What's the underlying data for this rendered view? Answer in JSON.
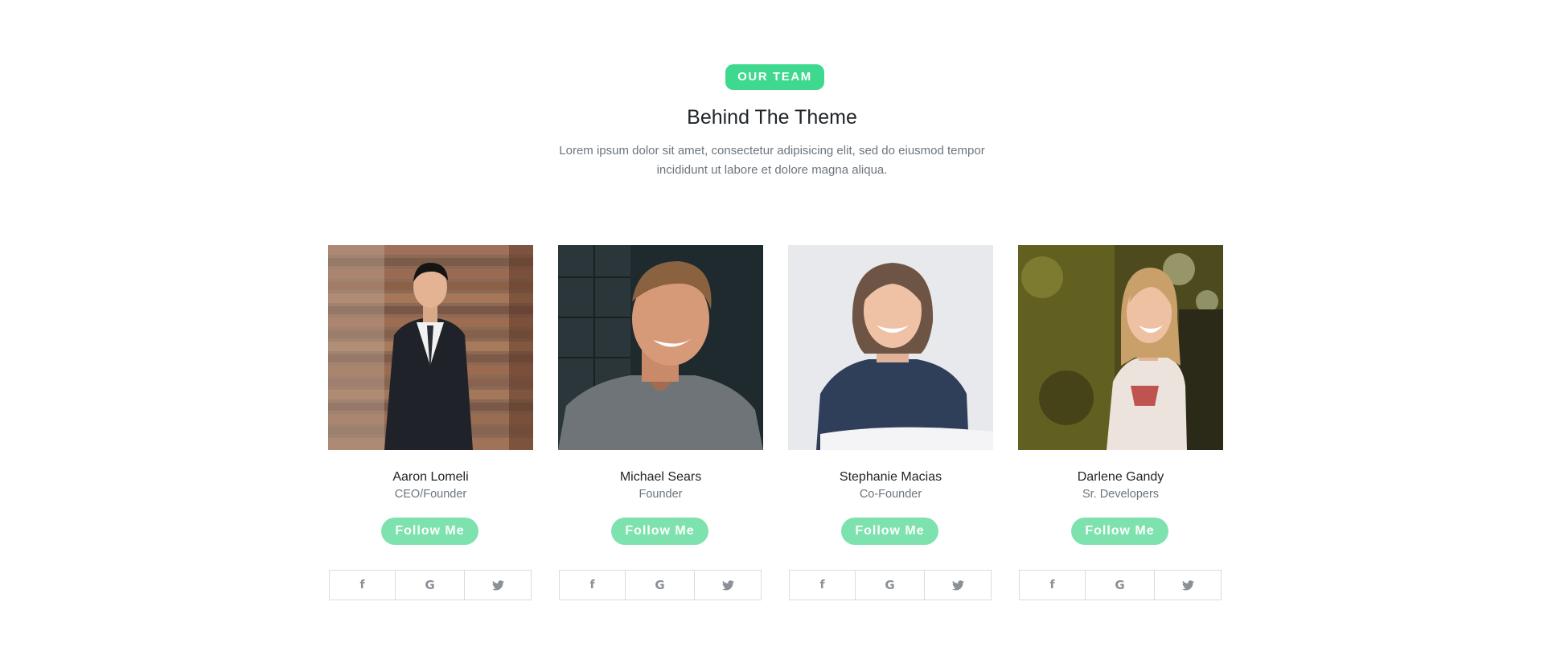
{
  "header": {
    "badge": "OUR TEAM",
    "title": "Behind The Theme",
    "description": "Lorem ipsum dolor sit amet, consectetur adipisicing elit, sed do eiusmod tempor incididunt ut labore et dolore magna aliqua."
  },
  "colors": {
    "accent": "#3ed88e",
    "follow_button": "#7ee2ae",
    "heading": "#212529",
    "muted_text": "#6c757d",
    "social_border": "#d9dcdf"
  },
  "team": [
    {
      "name": "Aaron Lomeli",
      "role": "CEO/Founder",
      "follow_label": "Follow Me",
      "photo": "man-in-suit-photo"
    },
    {
      "name": "Michael Sears",
      "role": "Founder",
      "follow_label": "Follow Me",
      "photo": "smiling-man-photo"
    },
    {
      "name": "Stephanie Macias",
      "role": "Co-Founder",
      "follow_label": "Follow Me",
      "photo": "smiling-woman-photo"
    },
    {
      "name": "Darlene Gandy",
      "role": "Sr. Developers",
      "follow_label": "Follow Me",
      "photo": "laughing-woman-photo"
    }
  ],
  "social_icons": [
    "facebook-icon",
    "google-icon",
    "twitter-icon"
  ]
}
